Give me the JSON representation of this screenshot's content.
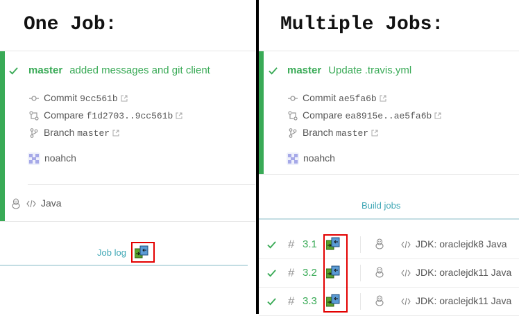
{
  "left": {
    "heading": "One Job:",
    "branch": "master",
    "commit_message": "added messages and git client",
    "commit_label": "Commit",
    "commit_hash": "9cc561b",
    "compare_label": "Compare",
    "compare_range": "f1d2703..9cc561b",
    "branch_label": "Branch",
    "branch_name": "master",
    "author": "noahch",
    "language": "Java",
    "job_log_label": "Job log"
  },
  "right": {
    "heading": "Multiple Jobs:",
    "branch": "master",
    "commit_message": "Update .travis.yml",
    "commit_label": "Commit",
    "commit_hash": "ae5fa6b",
    "compare_label": "Compare",
    "compare_range": "ea8915e..ae5fa6b",
    "branch_label": "Branch",
    "branch_name": "master",
    "author": "noahch",
    "build_jobs_label": "Build jobs",
    "jobs": [
      {
        "number": "3.1",
        "env": "JDK: oraclejdk8 Java"
      },
      {
        "number": "3.2",
        "env": "JDK: oraclejdk11 Java"
      },
      {
        "number": "3.3",
        "env": "JDK: oraclejdk11 Java"
      }
    ]
  },
  "colors": {
    "passed": "#39aa56",
    "link": "#3fa7b5",
    "highlight": "#e30000"
  },
  "icons": [
    "check-icon",
    "commit-icon",
    "compare-icon",
    "branch-icon",
    "external-link-icon",
    "avatar",
    "linux-icon",
    "code-icon",
    "job-log-icon",
    "hash-icon"
  ]
}
